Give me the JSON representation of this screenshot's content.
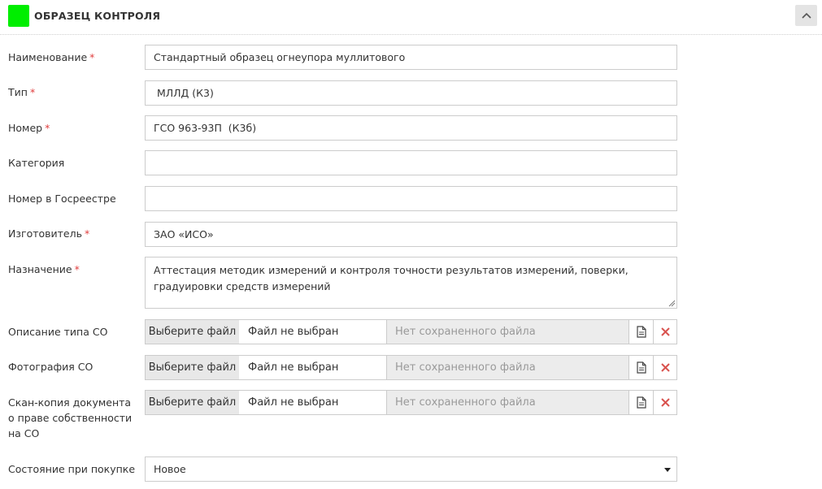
{
  "panel": {
    "title": "ОБРАЗЕЦ КОНТРОЛЯ",
    "accent_color": "#00ee00",
    "collapse_icon": "chevron-up-icon"
  },
  "form": {
    "required_mark": "*",
    "name": {
      "label": "Наименование",
      "value": "Стандартный образец огнеупора муллитового"
    },
    "type": {
      "label": "Тип",
      "value": " МЛЛД (К3)"
    },
    "number": {
      "label": "Номер",
      "value": "ГСО 963-93П  (К3б)"
    },
    "category": {
      "label": "Категория",
      "value": ""
    },
    "registry_number": {
      "label": "Номер в Госреестре",
      "value": ""
    },
    "manufacturer": {
      "label": "Изготовитель",
      "value": "ЗАО «ИСО»"
    },
    "purpose": {
      "label": "Назначение",
      "value": "Аттестация методик измерений и контроля точности результатов измерений, поверки, градуировки средств измерений"
    },
    "files": [
      {
        "label": "Описание типа СО",
        "choose": "Выберите файл",
        "chosen": "Файл не выбран",
        "saved": "Нет сохраненного файла"
      },
      {
        "label": "Фотография СО",
        "choose": "Выберите файл",
        "chosen": "Файл не выбран",
        "saved": "Нет сохраненного файла"
      },
      {
        "label": "Скан-копия документа о праве собственности на СО",
        "choose": "Выберите файл",
        "chosen": "Файл не выбран",
        "saved": "Нет сохраненного файла"
      }
    ],
    "condition": {
      "label": "Состояние при покупке",
      "value": "Новое"
    }
  }
}
